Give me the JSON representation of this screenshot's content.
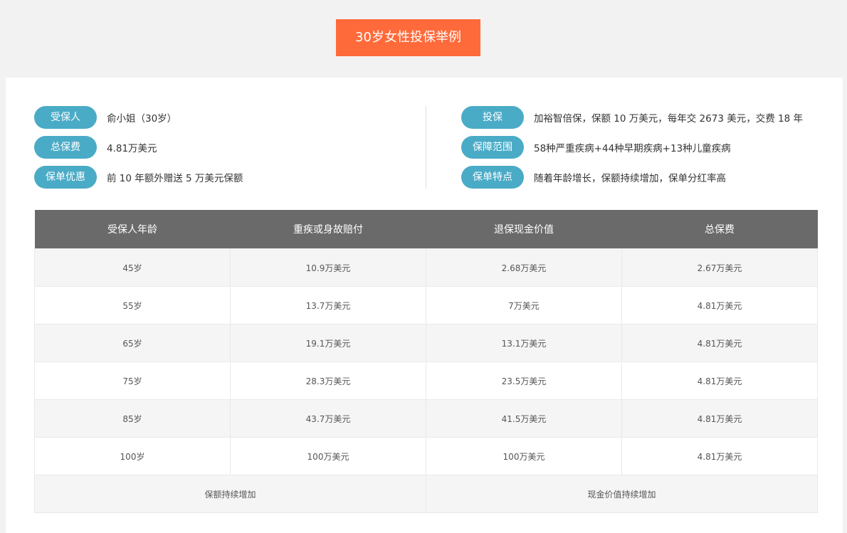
{
  "title": "30岁女性投保举例",
  "info_left": [
    {
      "label": "受保人",
      "value": "俞小姐（30岁）"
    },
    {
      "label": "总保费",
      "value": "4.81万美元"
    },
    {
      "label": "保单优惠",
      "value": "前 10 年额外赠送 5 万美元保额"
    }
  ],
  "info_right": [
    {
      "label": "投保",
      "value": "加裕智倍保，保额 10 万美元，每年交 2673 美元，交费 18 年"
    },
    {
      "label": "保障范围",
      "value": "58种严重疾病+44种早期疾病+13种儿童疾病"
    },
    {
      "label": "保单特点",
      "value": "随着年龄增长，保额持续增加，保单分红率高"
    }
  ],
  "table": {
    "headers": [
      "受保人年龄",
      "重疾或身故赔付",
      "退保现金价值",
      "总保费"
    ],
    "rows": [
      [
        "45岁",
        "10.9万美元",
        "2.68万美元",
        "2.67万美元"
      ],
      [
        "55岁",
        "13.7万美元",
        "7万美元",
        "4.81万美元"
      ],
      [
        "65岁",
        "19.1万美元",
        "13.1万美元",
        "4.81万美元"
      ],
      [
        "75岁",
        "28.3万美元",
        "23.5万美元",
        "4.81万美元"
      ],
      [
        "85岁",
        "43.7万美元",
        "41.5万美元",
        "4.81万美元"
      ],
      [
        "100岁",
        "100万美元",
        "100万美元",
        "4.81万美元"
      ]
    ],
    "footer": [
      "保额持续增加",
      "现金价值持续增加"
    ]
  },
  "colors": {
    "title_bg": "#ff6a3a",
    "pill_bg": "#4aabc7",
    "header_bg": "#6a6a6a"
  }
}
